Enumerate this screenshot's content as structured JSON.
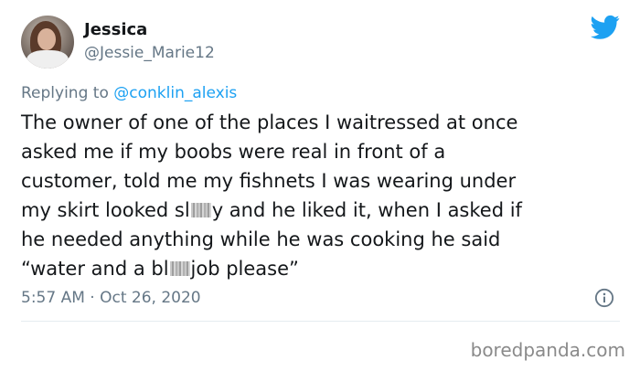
{
  "tweet": {
    "author_name": "Jessica",
    "author_handle": "@Jessie_Marie12",
    "reply_prefix": "Replying to",
    "reply_to": "@conklin_alexis",
    "lines": [
      "The owner of one of the places I waitressed at once",
      "asked me if my boobs were real in front of a",
      "customer, told me my fishnets I was wearing under",
      [
        "my skirt looked sl",
        "y and he liked it, when I asked if"
      ],
      "he needed anything while he was cooking he said",
      [
        "“water and a bl",
        "job please”"
      ]
    ],
    "timestamp": "5:57 AM · Oct 26, 2020"
  },
  "icons": {
    "logo": "twitter-bird-icon",
    "info": "info-icon"
  },
  "colors": {
    "accent": "#1da1f2",
    "muted": "#657786",
    "text": "#14171a"
  },
  "watermark": "boredpanda.com"
}
